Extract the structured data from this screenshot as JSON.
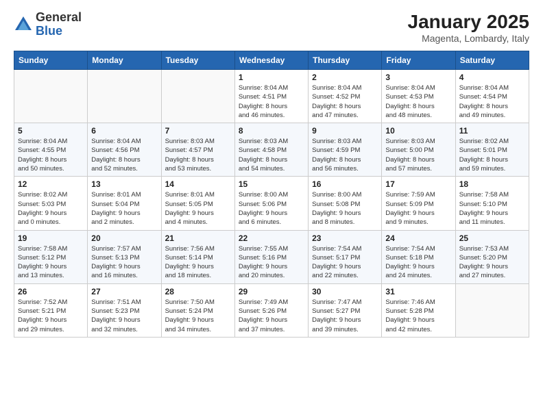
{
  "logo": {
    "general": "General",
    "blue": "Blue"
  },
  "header": {
    "month": "January 2025",
    "location": "Magenta, Lombardy, Italy"
  },
  "weekdays": [
    "Sunday",
    "Monday",
    "Tuesday",
    "Wednesday",
    "Thursday",
    "Friday",
    "Saturday"
  ],
  "weeks": [
    [
      {
        "day": "",
        "info": ""
      },
      {
        "day": "",
        "info": ""
      },
      {
        "day": "",
        "info": ""
      },
      {
        "day": "1",
        "info": "Sunrise: 8:04 AM\nSunset: 4:51 PM\nDaylight: 8 hours\nand 46 minutes."
      },
      {
        "day": "2",
        "info": "Sunrise: 8:04 AM\nSunset: 4:52 PM\nDaylight: 8 hours\nand 47 minutes."
      },
      {
        "day": "3",
        "info": "Sunrise: 8:04 AM\nSunset: 4:53 PM\nDaylight: 8 hours\nand 48 minutes."
      },
      {
        "day": "4",
        "info": "Sunrise: 8:04 AM\nSunset: 4:54 PM\nDaylight: 8 hours\nand 49 minutes."
      }
    ],
    [
      {
        "day": "5",
        "info": "Sunrise: 8:04 AM\nSunset: 4:55 PM\nDaylight: 8 hours\nand 50 minutes."
      },
      {
        "day": "6",
        "info": "Sunrise: 8:04 AM\nSunset: 4:56 PM\nDaylight: 8 hours\nand 52 minutes."
      },
      {
        "day": "7",
        "info": "Sunrise: 8:03 AM\nSunset: 4:57 PM\nDaylight: 8 hours\nand 53 minutes."
      },
      {
        "day": "8",
        "info": "Sunrise: 8:03 AM\nSunset: 4:58 PM\nDaylight: 8 hours\nand 54 minutes."
      },
      {
        "day": "9",
        "info": "Sunrise: 8:03 AM\nSunset: 4:59 PM\nDaylight: 8 hours\nand 56 minutes."
      },
      {
        "day": "10",
        "info": "Sunrise: 8:03 AM\nSunset: 5:00 PM\nDaylight: 8 hours\nand 57 minutes."
      },
      {
        "day": "11",
        "info": "Sunrise: 8:02 AM\nSunset: 5:01 PM\nDaylight: 8 hours\nand 59 minutes."
      }
    ],
    [
      {
        "day": "12",
        "info": "Sunrise: 8:02 AM\nSunset: 5:03 PM\nDaylight: 9 hours\nand 0 minutes."
      },
      {
        "day": "13",
        "info": "Sunrise: 8:01 AM\nSunset: 5:04 PM\nDaylight: 9 hours\nand 2 minutes."
      },
      {
        "day": "14",
        "info": "Sunrise: 8:01 AM\nSunset: 5:05 PM\nDaylight: 9 hours\nand 4 minutes."
      },
      {
        "day": "15",
        "info": "Sunrise: 8:00 AM\nSunset: 5:06 PM\nDaylight: 9 hours\nand 6 minutes."
      },
      {
        "day": "16",
        "info": "Sunrise: 8:00 AM\nSunset: 5:08 PM\nDaylight: 9 hours\nand 8 minutes."
      },
      {
        "day": "17",
        "info": "Sunrise: 7:59 AM\nSunset: 5:09 PM\nDaylight: 9 hours\nand 9 minutes."
      },
      {
        "day": "18",
        "info": "Sunrise: 7:58 AM\nSunset: 5:10 PM\nDaylight: 9 hours\nand 11 minutes."
      }
    ],
    [
      {
        "day": "19",
        "info": "Sunrise: 7:58 AM\nSunset: 5:12 PM\nDaylight: 9 hours\nand 13 minutes."
      },
      {
        "day": "20",
        "info": "Sunrise: 7:57 AM\nSunset: 5:13 PM\nDaylight: 9 hours\nand 16 minutes."
      },
      {
        "day": "21",
        "info": "Sunrise: 7:56 AM\nSunset: 5:14 PM\nDaylight: 9 hours\nand 18 minutes."
      },
      {
        "day": "22",
        "info": "Sunrise: 7:55 AM\nSunset: 5:16 PM\nDaylight: 9 hours\nand 20 minutes."
      },
      {
        "day": "23",
        "info": "Sunrise: 7:54 AM\nSunset: 5:17 PM\nDaylight: 9 hours\nand 22 minutes."
      },
      {
        "day": "24",
        "info": "Sunrise: 7:54 AM\nSunset: 5:18 PM\nDaylight: 9 hours\nand 24 minutes."
      },
      {
        "day": "25",
        "info": "Sunrise: 7:53 AM\nSunset: 5:20 PM\nDaylight: 9 hours\nand 27 minutes."
      }
    ],
    [
      {
        "day": "26",
        "info": "Sunrise: 7:52 AM\nSunset: 5:21 PM\nDaylight: 9 hours\nand 29 minutes."
      },
      {
        "day": "27",
        "info": "Sunrise: 7:51 AM\nSunset: 5:23 PM\nDaylight: 9 hours\nand 32 minutes."
      },
      {
        "day": "28",
        "info": "Sunrise: 7:50 AM\nSunset: 5:24 PM\nDaylight: 9 hours\nand 34 minutes."
      },
      {
        "day": "29",
        "info": "Sunrise: 7:49 AM\nSunset: 5:26 PM\nDaylight: 9 hours\nand 37 minutes."
      },
      {
        "day": "30",
        "info": "Sunrise: 7:47 AM\nSunset: 5:27 PM\nDaylight: 9 hours\nand 39 minutes."
      },
      {
        "day": "31",
        "info": "Sunrise: 7:46 AM\nSunset: 5:28 PM\nDaylight: 9 hours\nand 42 minutes."
      },
      {
        "day": "",
        "info": ""
      }
    ]
  ]
}
